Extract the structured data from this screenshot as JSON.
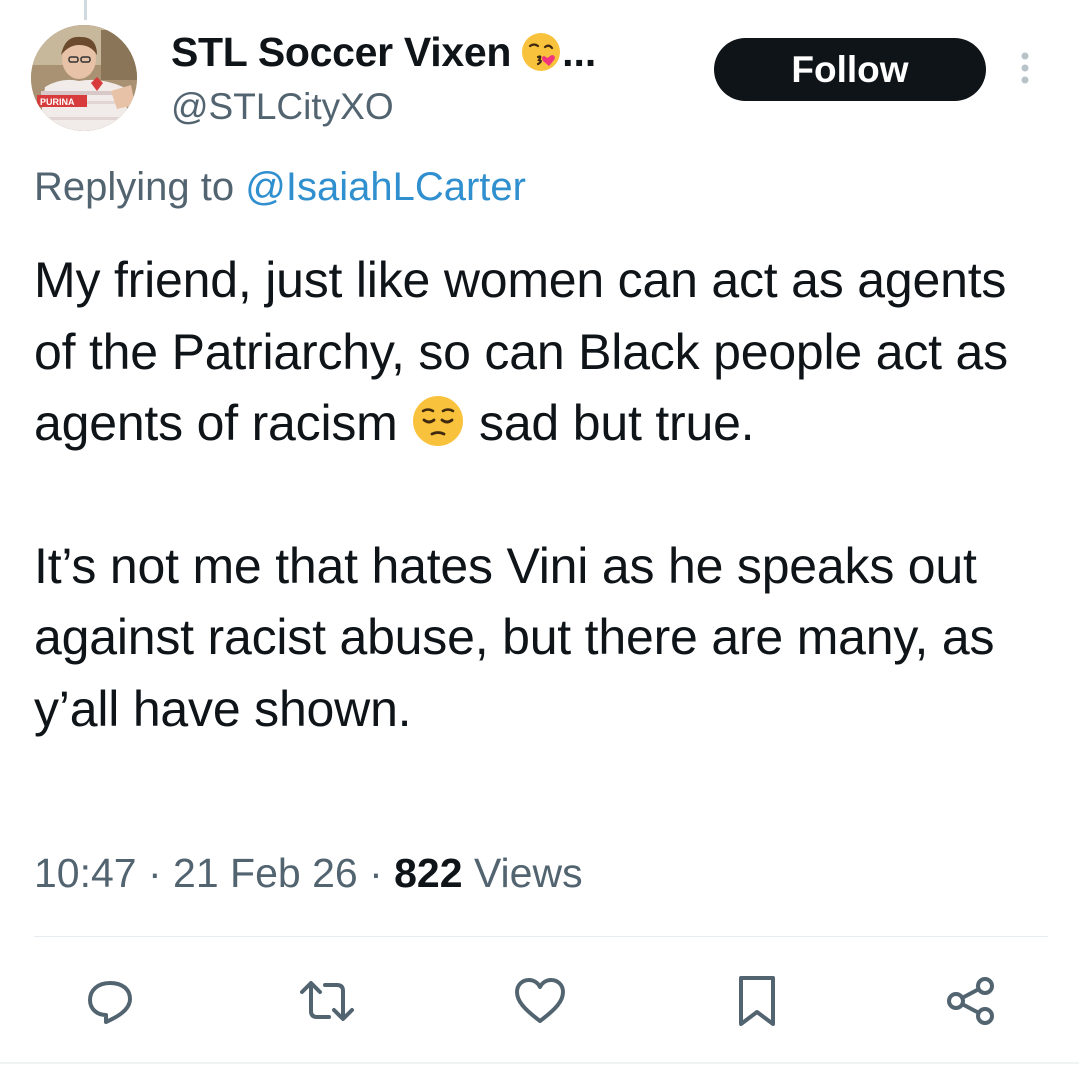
{
  "author": {
    "display_name": "STL Soccer Vixen",
    "name_emoji": "face-blowing-a-kiss-emoji",
    "name_ellipsis": "...",
    "handle": "@STLCityXO",
    "avatar_shirt_text": "PURINA"
  },
  "follow_button": {
    "label": "Follow"
  },
  "reply": {
    "prefix": "Replying to ",
    "handle": "@IsaiahLCarter"
  },
  "tweet": {
    "paragraph1_part1": "My friend, just like women can act as agents of the Patriarchy, so can Black people act as agents of racism ",
    "paragraph1_emoji": "pensive-face-emoji",
    "paragraph1_part2": " sad but true.",
    "paragraph2": "It’s not me that hates Vini as he speaks out against racist abuse, but there are many, as y’all have shown."
  },
  "meta": {
    "time": "10:47",
    "sep1": " · ",
    "date": "21 Feb 26",
    "sep2": " · ",
    "views_count": "822",
    "views_label": " Views"
  },
  "actions": {
    "reply_icon": "reply-icon",
    "retweet_icon": "retweet-icon",
    "like_icon": "heart-icon",
    "bookmark_icon": "bookmark-icon",
    "share_icon": "share-icon"
  },
  "colors": {
    "text_primary": "#0f1419",
    "text_secondary": "#536471",
    "link": "#2f8fcf",
    "button_bg": "#0f1419",
    "divider": "#e6ecf0"
  }
}
